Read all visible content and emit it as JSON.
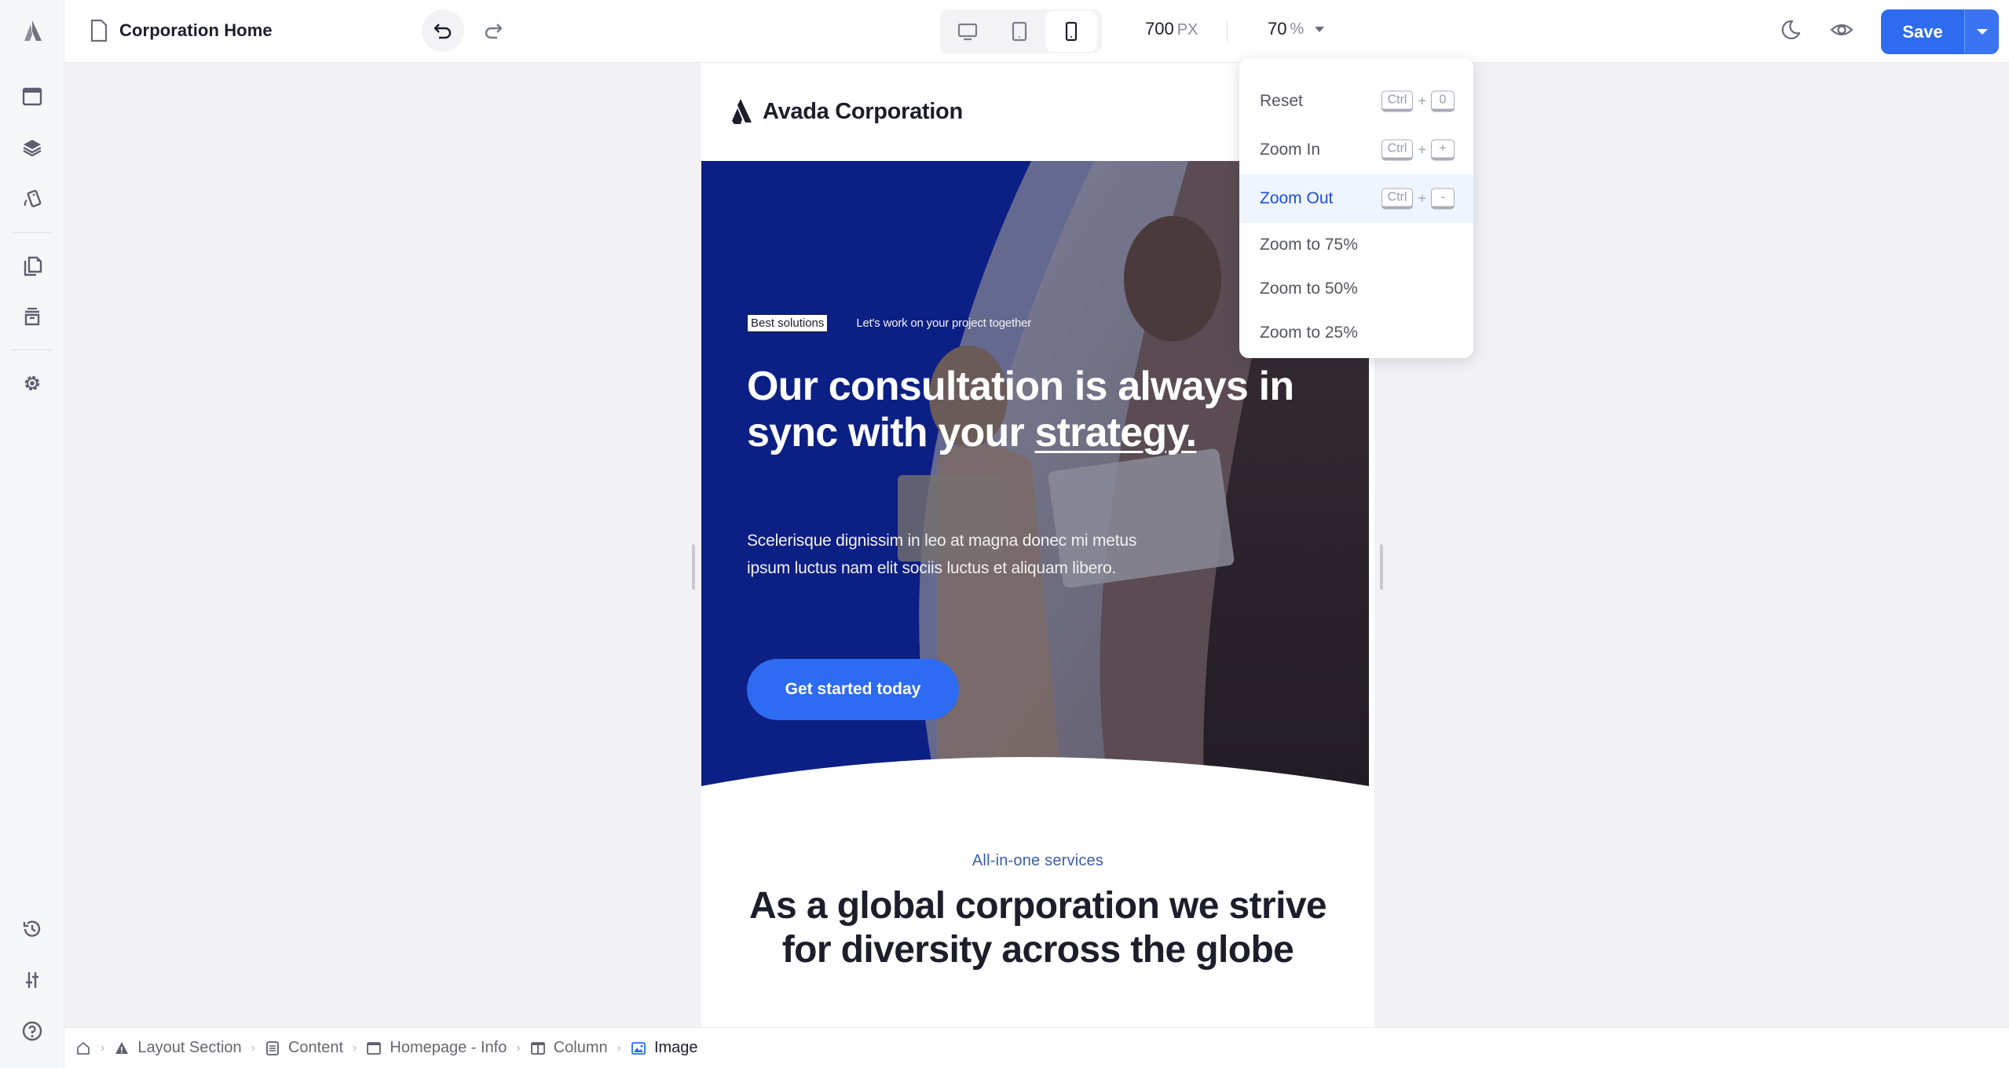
{
  "header": {
    "doc_title": "Corporation Home",
    "undo_icon": "undo-icon",
    "redo_icon": "redo-icon",
    "devices": [
      {
        "name": "desktop",
        "icon": "desktop-icon",
        "active": false
      },
      {
        "name": "tablet",
        "icon": "tablet-icon",
        "active": false
      },
      {
        "name": "mobile",
        "icon": "mobile-icon",
        "active": true
      }
    ],
    "width_value": "700",
    "width_unit": "PX",
    "zoom_value": "70",
    "zoom_unit": "%",
    "save_label": "Save"
  },
  "sidebar": {
    "top_items": [
      {
        "name": "sidebar-item-layout",
        "icon": "window-icon"
      },
      {
        "name": "sidebar-item-navigator",
        "icon": "layers-icon"
      },
      {
        "name": "sidebar-item-styles",
        "icon": "swatch-icon"
      },
      {
        "name": "sidebar-item-pages",
        "icon": "pages-icon"
      },
      {
        "name": "sidebar-item-library",
        "icon": "archive-icon"
      },
      {
        "name": "sidebar-item-settings",
        "icon": "gear-icon"
      }
    ],
    "bottom_items": [
      {
        "name": "sidebar-item-history",
        "icon": "history-icon"
      },
      {
        "name": "sidebar-item-options",
        "icon": "sliders-icon"
      },
      {
        "name": "sidebar-item-help",
        "icon": "help-icon"
      }
    ]
  },
  "zoom_menu": {
    "items": [
      {
        "label": "Reset",
        "keys": [
          "Ctrl",
          "0"
        ],
        "active": false
      },
      {
        "label": "Zoom In",
        "keys": [
          "Ctrl",
          "+"
        ],
        "active": false
      },
      {
        "label": "Zoom Out",
        "keys": [
          "Ctrl",
          "-"
        ],
        "active": true
      },
      {
        "label": "Zoom to 75%",
        "keys": [],
        "active": false
      },
      {
        "label": "Zoom to 50%",
        "keys": [],
        "active": false
      },
      {
        "label": "Zoom to 25%",
        "keys": [],
        "active": false
      }
    ],
    "plus": "+"
  },
  "preview": {
    "site_name": "Avada Corporation",
    "hero": {
      "tag": "Best solutions",
      "tagline": "Let's work on your project together",
      "title_part1": "Our consultation is always in sync with your ",
      "title_underlined": "strategy.",
      "description": "Scelerisque dignissim in leo at magna donec mi metus ipsum luctus nam elit sociis luctus et aliquam libero.",
      "cta": "Get started today"
    },
    "section2": {
      "kicker": "All-in-one services",
      "title": "As a global corporation we strive for diversity across the globe"
    }
  },
  "breadcrumbs": [
    {
      "label": "",
      "icon": "home-icon"
    },
    {
      "label": "Layout Section",
      "icon": "layout-section-icon"
    },
    {
      "label": "Content",
      "icon": "content-icon"
    },
    {
      "label": "Homepage - Info",
      "icon": "container-icon"
    },
    {
      "label": "Column",
      "icon": "column-icon"
    },
    {
      "label": "Image",
      "icon": "image-icon"
    }
  ],
  "colors": {
    "accent": "#2d6bf0",
    "hero_blue": "#0c1f85",
    "active_menu_bg": "#eef5fe",
    "active_menu_text": "#1e4fd8",
    "kicker": "#3d5ca8"
  }
}
